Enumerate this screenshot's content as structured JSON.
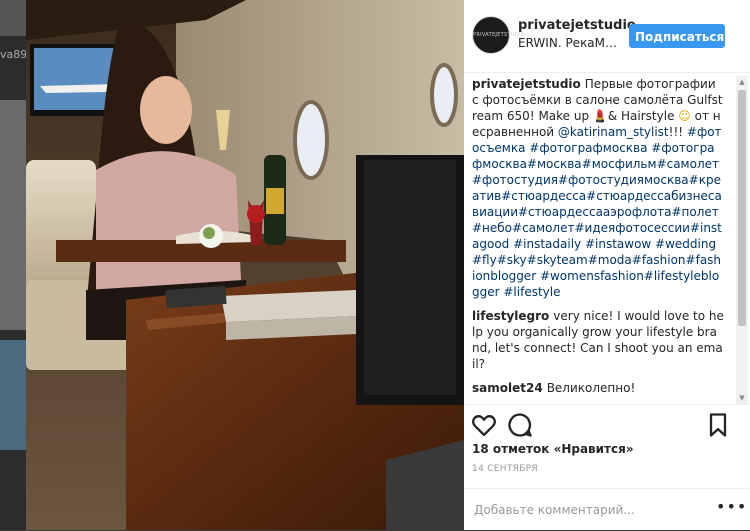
{
  "background": {
    "partial_username": "va89"
  },
  "post": {
    "username": "privatejetstudio",
    "location": "ERWIN. РекаМ…",
    "follow_label": "Подписаться",
    "avatar_text": "PRIVATEJETSTUDIO",
    "caption": {
      "user": "privatejetstudio",
      "text_1": "Первые фотографии с фотосъёмки в салоне самолёта Gulfstream 650! Make up ",
      "text_2": "& Hairstyle ",
      "text_3": " от несравненной ",
      "mention": "@katirinam_stylist",
      "text_4": "!!! ",
      "hashtags": "#фотосъемка #фотографмосква #фотографмосква#москва#мосфильм#самолет#фотостудия#фотостудиямосква#креатив#стюардесса#стюардессабизнесавиации#стюардессааэрофлота#полет#небо#самолет#идеяфотосессии#instagood #instadaily #instawow #wedding#fly#sky#skyteam#moda#fashion#fashionblogger #womensfashion#lifestyleblogger #lifestyle"
    },
    "comments": [
      {
        "user": "lifestylegro",
        "text": "very nice! I would love to help you organically grow your lifestyle brand, let's connect! Can I shoot you an email?"
      },
      {
        "user": "samolet24",
        "text": "Великолепно!"
      }
    ],
    "likes_count": "18 отметок",
    "likes_label": "«Нравится»",
    "date": "14 СЕНТЯБРЯ",
    "comment_placeholder": "Добавьте комментарий...",
    "more_dots": "•••"
  },
  "icons": [
    "heart-icon",
    "comment-icon",
    "bookmark-icon"
  ],
  "colors": {
    "follow_button": "#3897f0",
    "link": "#003569",
    "text": "#262626"
  }
}
